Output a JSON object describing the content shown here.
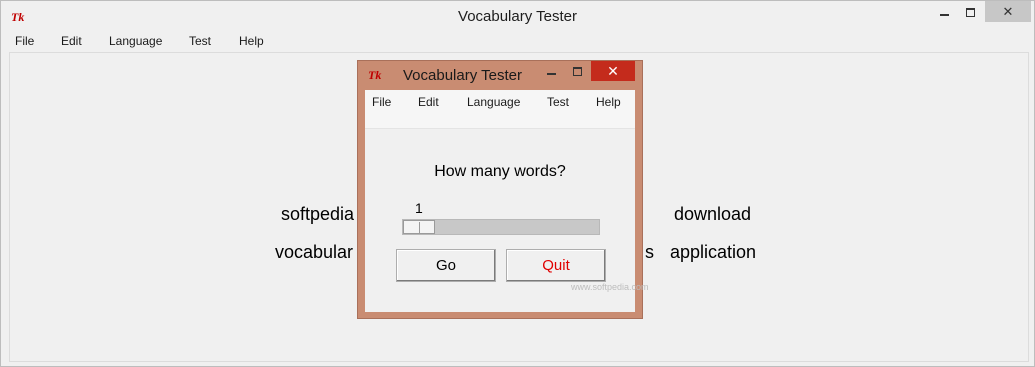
{
  "main_window": {
    "title": "Vocabulary Tester",
    "logo": "Tk",
    "controls": {
      "minimize": "minimize-icon",
      "maximize": "maximize-icon",
      "close": "✕"
    },
    "menu": [
      "File",
      "Edit",
      "Language",
      "Test",
      "Help"
    ],
    "background_words": {
      "row1_left": "softpedia",
      "row1_right": "download",
      "row2_left": "vocabular",
      "row2_s": "s",
      "row2_right": "application"
    }
  },
  "dialog": {
    "title": "Vocabulary Tester",
    "logo": "Tk",
    "close_symbol": "✕",
    "menu": [
      "File",
      "Edit",
      "Language",
      "Test",
      "Help"
    ],
    "question": "How many words?",
    "scale": {
      "value": "1",
      "level": 0.0
    },
    "buttons": {
      "go": "Go",
      "quit": "Quit"
    },
    "watermark": "www.softpedia.com"
  },
  "colors": {
    "dialog_frame": "#c98c72",
    "close_button": "#c42b1c",
    "quit_text": "#e00000",
    "logo": "#c00000"
  }
}
